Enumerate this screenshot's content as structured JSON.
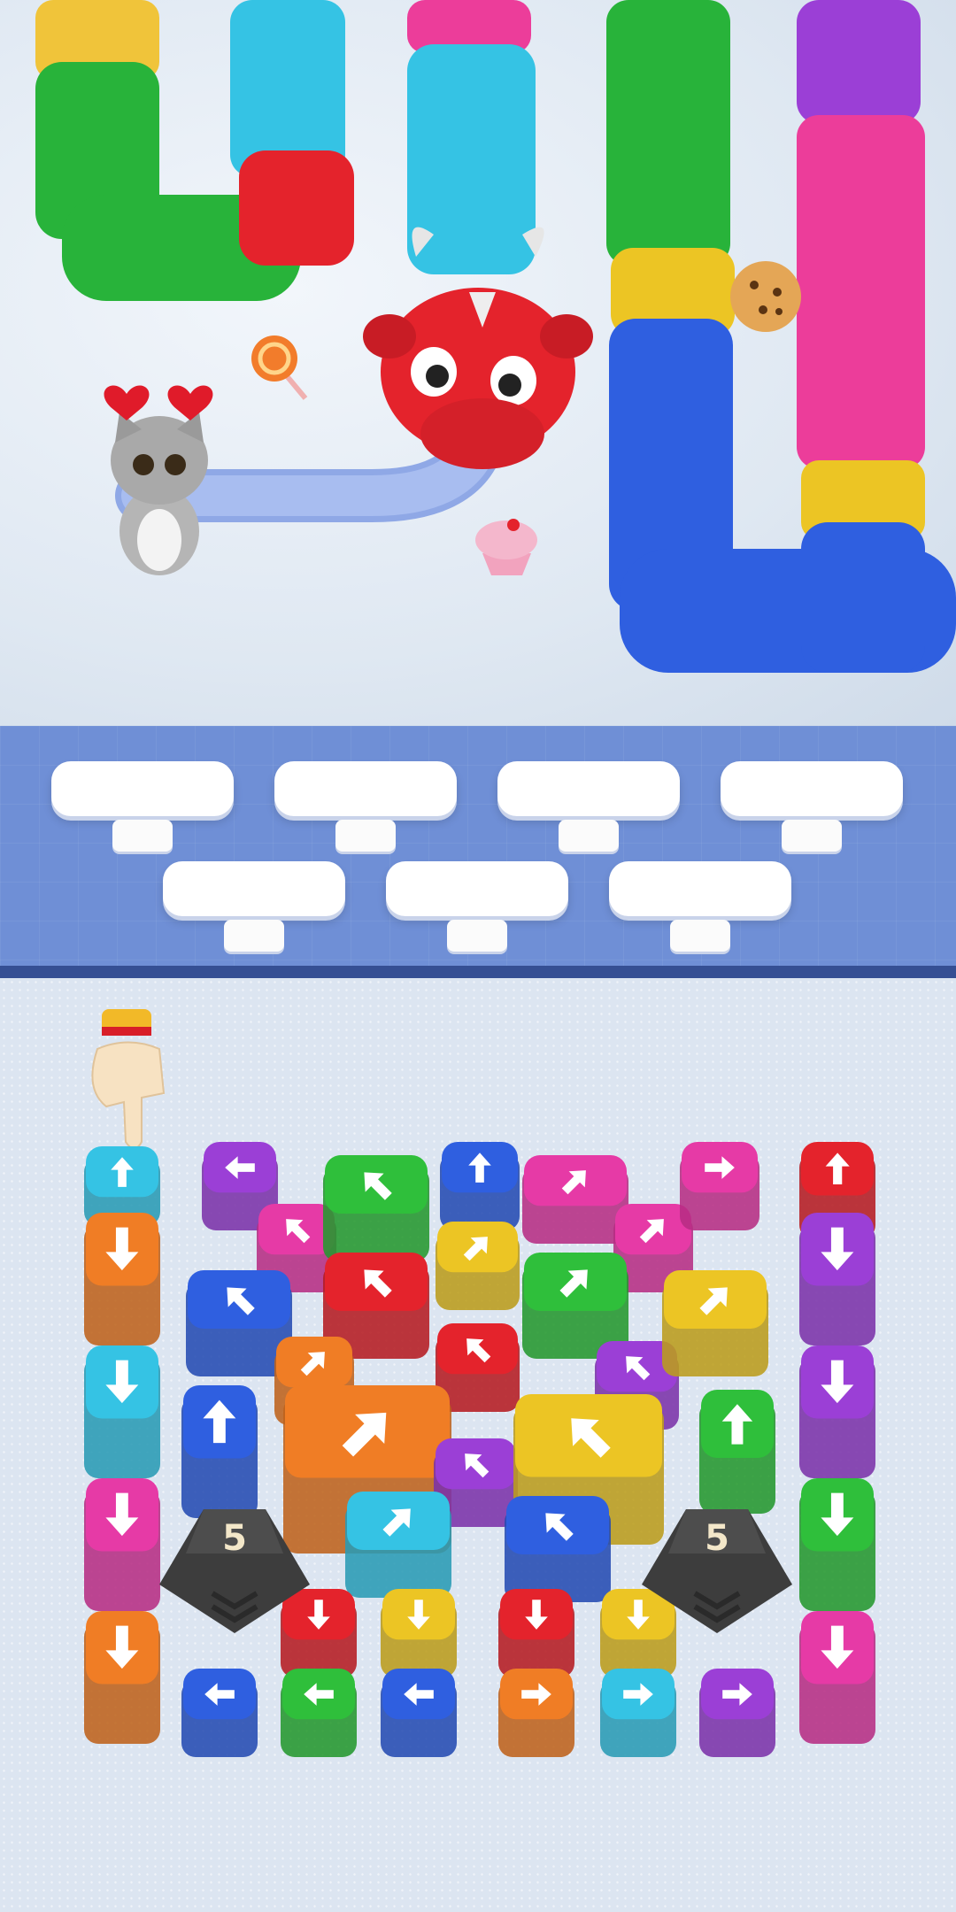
{
  "game": {
    "arena": {
      "characters": [
        {
          "name": "kitten",
          "icon": "kitten-icon"
        },
        {
          "name": "dragon",
          "icon": "dragon-head-icon"
        }
      ],
      "items": [
        {
          "name": "heart",
          "icon": "heart-icon"
        },
        {
          "name": "heart",
          "icon": "heart-icon"
        },
        {
          "name": "lollipop",
          "icon": "lollipop-icon"
        },
        {
          "name": "cookie",
          "icon": "cookie-icon"
        },
        {
          "name": "cupcake",
          "icon": "cupcake-icon"
        }
      ]
    },
    "shelf": {
      "slot_count": 7,
      "filled": 0
    },
    "blockers": [
      {
        "label": "5"
      },
      {
        "label": "5"
      }
    ],
    "spools": [
      {
        "color": "cyan",
        "dir": "up"
      },
      {
        "color": "orange",
        "dir": "down"
      },
      {
        "color": "cyan",
        "dir": "down"
      },
      {
        "color": "magenta",
        "dir": "down"
      },
      {
        "color": "orange",
        "dir": "down"
      },
      {
        "color": "purple",
        "dir": "left"
      },
      {
        "color": "magenta",
        "dir": "up-left"
      },
      {
        "color": "blue",
        "dir": "up-left"
      },
      {
        "color": "green",
        "dir": "up-left"
      },
      {
        "color": "red",
        "dir": "up-left"
      },
      {
        "color": "orange",
        "dir": "up-right"
      },
      {
        "color": "blue",
        "dir": "up"
      },
      {
        "color": "blue",
        "dir": "up"
      },
      {
        "color": "yellow",
        "dir": "up-right"
      },
      {
        "color": "red",
        "dir": "up-left"
      },
      {
        "color": "orange",
        "dir": "up-right"
      },
      {
        "color": "purple",
        "dir": "up-left"
      },
      {
        "color": "cyan",
        "dir": "up-right"
      },
      {
        "color": "magenta",
        "dir": "up-right"
      },
      {
        "color": "magenta",
        "dir": "up-right"
      },
      {
        "color": "green",
        "dir": "up-right"
      },
      {
        "color": "purple",
        "dir": "up-left"
      },
      {
        "color": "yellow",
        "dir": "up-left"
      },
      {
        "color": "blue",
        "dir": "up-left"
      },
      {
        "color": "magenta",
        "dir": "right"
      },
      {
        "color": "yellow",
        "dir": "up-right"
      },
      {
        "color": "green",
        "dir": "up"
      },
      {
        "color": "red",
        "dir": "up"
      },
      {
        "color": "purple",
        "dir": "down"
      },
      {
        "color": "purple",
        "dir": "down"
      },
      {
        "color": "green",
        "dir": "down"
      },
      {
        "color": "magenta",
        "dir": "down"
      },
      {
        "color": "red",
        "dir": "down"
      },
      {
        "color": "yellow",
        "dir": "down"
      },
      {
        "color": "red",
        "dir": "down"
      },
      {
        "color": "yellow",
        "dir": "down"
      },
      {
        "color": "blue",
        "dir": "left"
      },
      {
        "color": "green",
        "dir": "left"
      },
      {
        "color": "blue",
        "dir": "left"
      },
      {
        "color": "orange",
        "dir": "right"
      },
      {
        "color": "cyan",
        "dir": "right"
      },
      {
        "color": "purple",
        "dir": "right"
      }
    ],
    "palette": {
      "cyan": "#35c3e4",
      "orange": "#f07d25",
      "magenta": "#e63aa6",
      "purple": "#9b3fd6",
      "blue": "#2f5fe0",
      "green": "#2fbf3b",
      "red": "#e4232c",
      "yellow": "#ecc524"
    }
  }
}
